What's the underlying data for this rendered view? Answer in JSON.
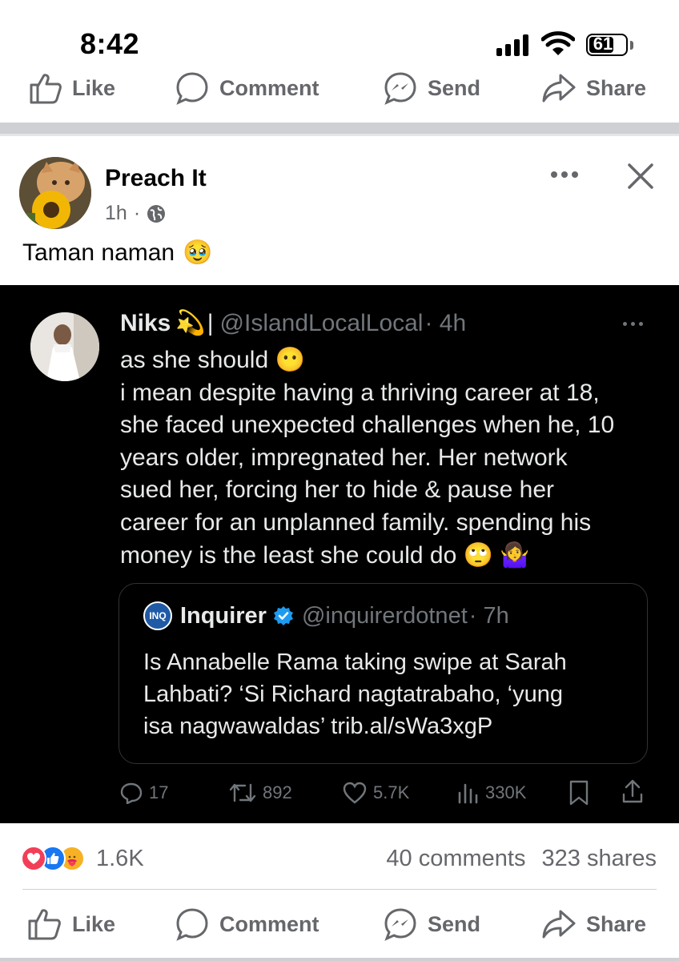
{
  "status_bar": {
    "time": "8:42",
    "battery": "61"
  },
  "top_actions": [
    {
      "label": "Like",
      "icon": "thumbs-up-icon"
    },
    {
      "label": "Comment",
      "icon": "comment-icon"
    },
    {
      "label": "Send",
      "icon": "messenger-icon"
    },
    {
      "label": "Share",
      "icon": "share-icon"
    }
  ],
  "post": {
    "author": "Preach It",
    "time": "1h",
    "separator": "·",
    "audience_icon": "globe-icon",
    "caption": "Taman naman",
    "caption_emoji": "🥹"
  },
  "tweet": {
    "name": "Niks",
    "name_emoji": "💫",
    "name_bar": "|",
    "handle": "@IslandLocalLocal",
    "time": "· 4h",
    "lines": [
      "as she should",
      "i mean despite having a thriving career at 18,",
      "she faced unexpected challenges when he, 10",
      "years older, impregnated her. Her network",
      "sued her, forcing her to hide & pause her",
      "career for an unplanned family. spending his",
      "money is the least she could do"
    ],
    "emoji_line1": "😶",
    "emoji_last": "🙄 🤷‍♀️",
    "quote": {
      "logo": "INQ",
      "name": "Inquirer",
      "handle": "@inquirerdotnet",
      "time": "· 7h",
      "lines": [
        "Is Annabelle Rama taking swipe at Sarah",
        "Lahbati? ‘Si Richard nagtatrabaho, ‘yung",
        "isa nagwawaldas’ trib.al/sWa3xgP"
      ]
    },
    "stats": {
      "replies": "17",
      "retweets": "892",
      "likes": "5.7K",
      "views": "330K"
    }
  },
  "summary": {
    "reactions": "1.6K",
    "comments": "40 comments",
    "shares": "323 shares"
  },
  "bottom_actions": [
    {
      "label": "Like",
      "icon": "thumbs-up-icon"
    },
    {
      "label": "Comment",
      "icon": "comment-icon"
    },
    {
      "label": "Send",
      "icon": "messenger-icon"
    },
    {
      "label": "Share",
      "icon": "share-icon"
    }
  ],
  "colors": {
    "muted": "#65676b",
    "tweet_bg": "#000000",
    "tweet_text": "#e7e9ea",
    "tweet_muted": "#71767b",
    "love": "#f33e58",
    "like": "#1877f2",
    "care": "#f7b125"
  }
}
